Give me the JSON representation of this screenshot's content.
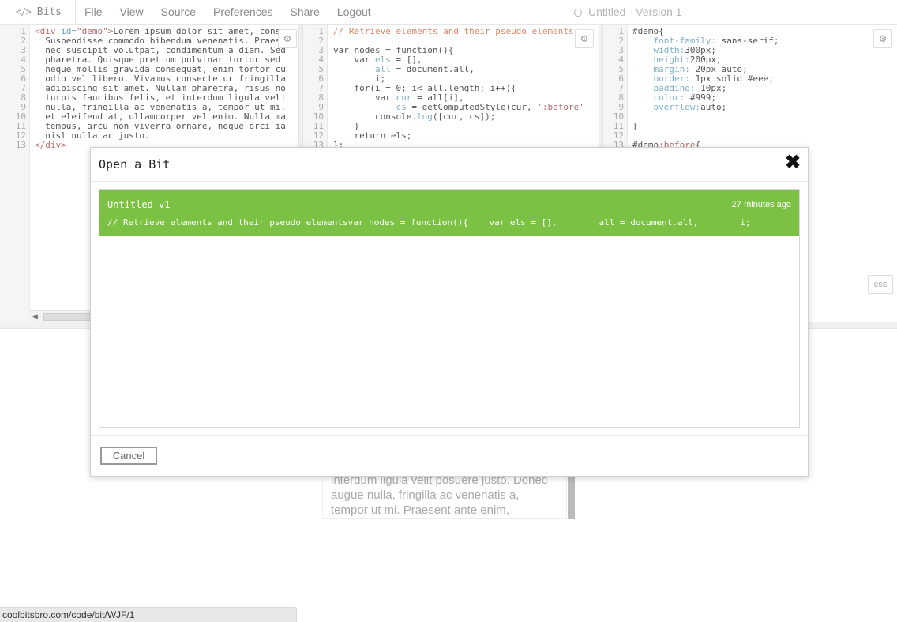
{
  "app": {
    "brand_icon": "</>",
    "brand": "Bits",
    "menu": [
      "File",
      "View",
      "Source",
      "Preferences",
      "Share",
      "Logout"
    ],
    "doc_title": "Untitled",
    "doc_separator": "·",
    "doc_version": "Version 1"
  },
  "editors": {
    "html_lines": [
      "<div id=\"demo\">Lorem ipsum dolor sit amet, conse",
      "  Suspendisse commodo bibendum venenatis. Praese",
      "  nec suscipit volutpat, condimentum a diam. Sed",
      "  pharetra. Quisque pretium pulvinar tortor sed ",
      "  neque mollis gravida consequat, enim tortor cu",
      "  odio vel libero. Vivamus consectetur fringilla",
      "  adipiscing sit amet. Nullam pharetra, risus no",
      "  turpis faucibus felis, et interdum ligula veli",
      "  nulla, fringilla ac venenatis a, tempor ut mi.",
      "  et eleifend at, ullamcorper vel enim. Nulla ma",
      "  tempus, arcu non viverra ornare, neque orci ia",
      "  nisl nulla ac justo.",
      "</div>"
    ],
    "js_lines": [
      "// Retrieve elements and their pseudo elements",
      "",
      "var nodes = function(){",
      "    var els = [],",
      "        all = document.all,",
      "        i;",
      "    for(i = 0; i< all.length; i++){",
      "        var cur = all[i],",
      "            cs = getComputedStyle(cur, ':before'",
      "        console.log([cur, cs]);",
      "    }",
      "    return els;",
      "};"
    ],
    "css_lines": [
      "#demo{",
      "    font-family: sans-serif;",
      "    width:300px;",
      "    height:200px;",
      "    margin: 20px auto;",
      "    border: 1px solid #eee;",
      "    padding: 10px;",
      "    color: #999;",
      "    overflow:auto;",
      "",
      "}",
      "",
      "#demo:before{"
    ],
    "line_numbers": [
      "1",
      "2",
      "3",
      "4",
      "5",
      "6",
      "7",
      "8",
      "9",
      "10",
      "11",
      "12",
      "13"
    ],
    "css_badge": "css",
    "gear_glyph": "⚙"
  },
  "preview": {
    "lines": [
      "interdum ligula velit posuere justo. Donec",
      "augue nulla, fringilla ac venenatis a,",
      "tempor ut mi. Praesent ante enim,"
    ]
  },
  "status": {
    "url": "coolbitsbro.com/code/bit/WJF/1"
  },
  "modal": {
    "title": "Open a Bit",
    "close_glyph": "✖",
    "bits": [
      {
        "title": "Untitled v1",
        "time": "27 minutes ago",
        "preview": "// Retrieve elements and their pseudo elementsvar nodes = function(){    var els = [],        all = document.all,        i;"
      }
    ],
    "cancel_label": "Cancel"
  },
  "colors": {
    "accent_green": "#7bc244",
    "menu_text": "#8a8a8a"
  }
}
